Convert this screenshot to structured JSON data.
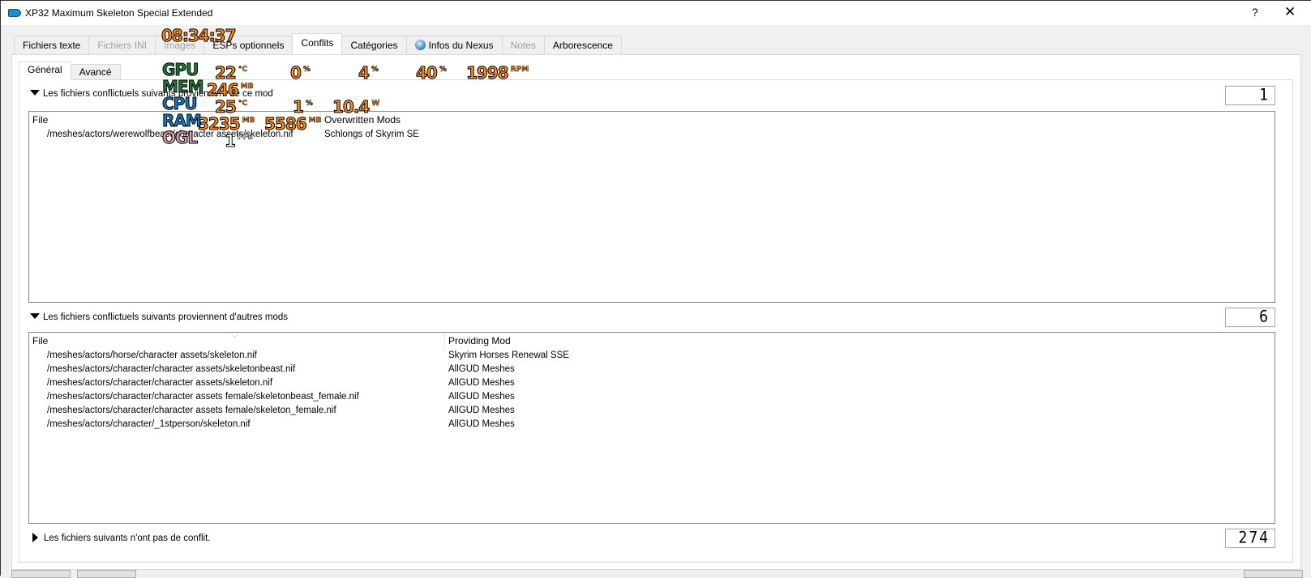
{
  "window": {
    "title": "XP32 Maximum Skeleton Special Extended",
    "help_label": "?",
    "close_label": "✕"
  },
  "tabs": [
    {
      "label": "Fichiers texte",
      "state": "normal"
    },
    {
      "label": "Fichiers INI",
      "state": "disabled"
    },
    {
      "label": "Images",
      "state": "disabled"
    },
    {
      "label": "ESPs optionnels",
      "state": "normal"
    },
    {
      "label": "Conflits",
      "state": "active"
    },
    {
      "label": "Catégories",
      "state": "normal"
    },
    {
      "label": "Infos du Nexus",
      "state": "normal",
      "icon": "globe-icon"
    },
    {
      "label": "Notes",
      "state": "disabled"
    },
    {
      "label": "Arborescence",
      "state": "normal"
    }
  ],
  "subtabs": [
    {
      "label": "Général",
      "state": "active"
    },
    {
      "label": "Avancé",
      "state": "normal"
    }
  ],
  "sections": {
    "overwrites": {
      "label": "Les fichiers conflictuels suivants proviennent de ce mod",
      "expanded": true,
      "count": "1",
      "columns": [
        "File",
        "Overwritten Mods"
      ],
      "rows": [
        {
          "file": "/meshes/actors/werewolfbeast/character assets/skeleton.nif",
          "mod": "Schlongs of Skyrim SE"
        }
      ]
    },
    "overwritten": {
      "label": "Les fichiers conflictuels suivants proviennent d'autres mods",
      "expanded": true,
      "count": "6",
      "columns": [
        "File",
        "Providing Mod"
      ],
      "rows": [
        {
          "file": "/meshes/actors/horse/character assets/skeleton.nif",
          "mod": "Skyrim Horses Renewal SSE"
        },
        {
          "file": "/meshes/actors/character/character assets/skeletonbeast.nif",
          "mod": "AllGUD Meshes"
        },
        {
          "file": "/meshes/actors/character/character assets/skeleton.nif",
          "mod": "AllGUD Meshes"
        },
        {
          "file": "/meshes/actors/character/character assets female/skeletonbeast_female.nif",
          "mod": "AllGUD Meshes"
        },
        {
          "file": "/meshes/actors/character/character assets female/skeleton_female.nif",
          "mod": "AllGUD Meshes"
        },
        {
          "file": "/meshes/actors/character/_1stperson/skeleton.nif",
          "mod": "AllGUD Meshes"
        }
      ]
    },
    "noconflict": {
      "label": "Les fichiers suivants n'ont pas de conflit.",
      "expanded": false,
      "count": "274"
    }
  },
  "osd": {
    "clock": "08:34:37",
    "gpu": {
      "label": "GPU",
      "temp": "22",
      "temp_unit": "°C",
      "load": "0",
      "load_unit": "%",
      "val3": "4",
      "val3_unit": "%",
      "fan_pct": "40",
      "fan_pct_unit": "%",
      "fan_rpm": "1998",
      "fan_rpm_unit": "RPM"
    },
    "mem": {
      "label": "MEM",
      "value": "246",
      "unit": "MB"
    },
    "cpu": {
      "label": "CPU",
      "temp": "25",
      "temp_unit": "°C",
      "load": "1",
      "load_unit": "%",
      "power": "10.4",
      "power_unit": "W"
    },
    "ram": {
      "label": "RAM",
      "used": "3235",
      "used_unit": "MB",
      "total": "5586",
      "total_unit": "MB"
    },
    "ogl": {
      "label": "OGL",
      "fps": "1",
      "fps_unit": "FPS"
    }
  }
}
